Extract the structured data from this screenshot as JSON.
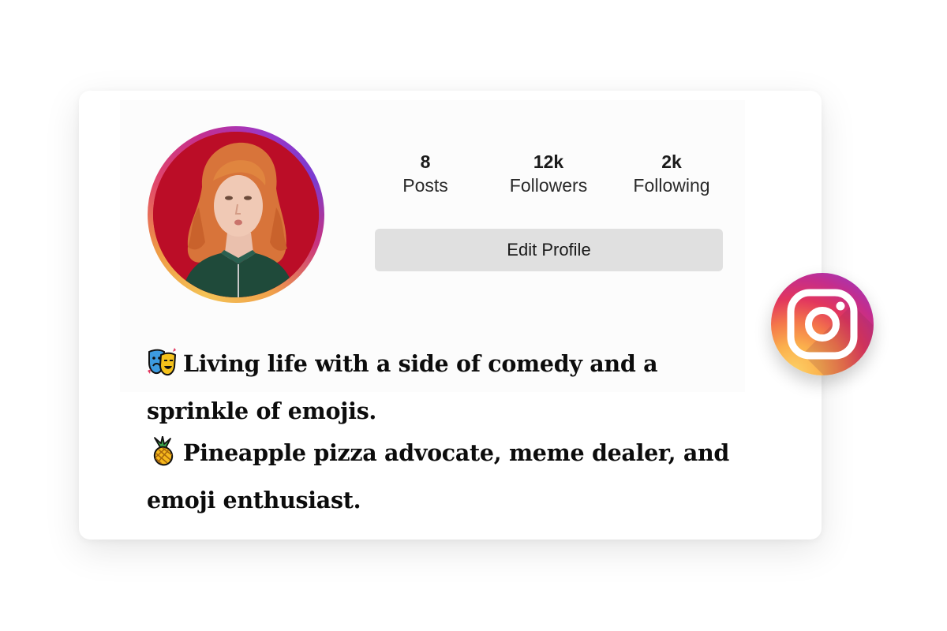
{
  "profile": {
    "stats": [
      {
        "value": "8",
        "label": "Posts"
      },
      {
        "value": "12k",
        "label": "Followers"
      },
      {
        "value": "2k",
        "label": "Following"
      }
    ],
    "edit_profile_label": "Edit Profile"
  },
  "bio": {
    "line1_emoji": "performing-arts-icon",
    "line1_text": "Living life with a side of comedy and a",
    "line2_text": "sprinkle of emojis.",
    "line3_emoji": "pineapple-icon",
    "line3_text": "Pineapple pizza advocate, meme dealer, and",
    "line4_text": "emoji enthusiast."
  },
  "brand": {
    "icon": "instagram-logo-icon"
  },
  "colors": {
    "avatar_background": "#bb0d27",
    "button_background": "#e0e0e0",
    "instagram_purple": "#8d3bd6",
    "instagram_pink": "#e2365e",
    "instagram_orange": "#f4784a",
    "instagram_yellow": "#fdd368"
  }
}
